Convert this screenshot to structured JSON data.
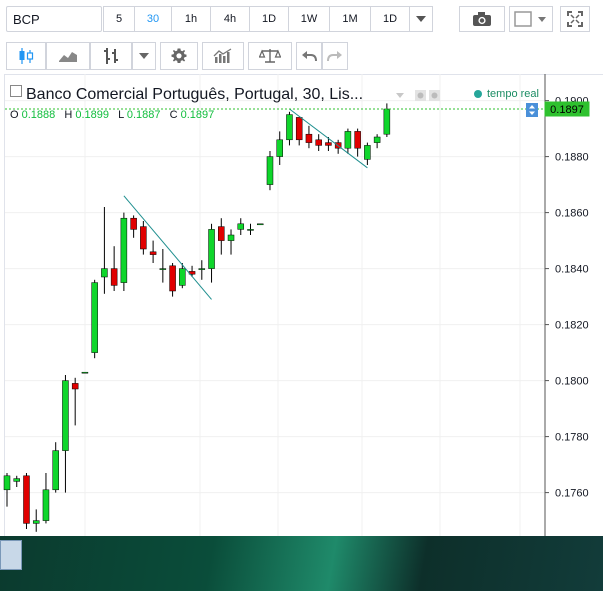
{
  "toolbar": {
    "symbol_value": "BCP",
    "intervals": [
      {
        "label": "5",
        "active": false
      },
      {
        "label": "30",
        "active": true
      },
      {
        "label": "1h",
        "active": false
      },
      {
        "label": "4h",
        "active": false
      },
      {
        "label": "1D",
        "active": false
      },
      {
        "label": "1W",
        "active": false
      },
      {
        "label": "1M",
        "active": false
      },
      {
        "label": "1D",
        "active": false
      }
    ]
  },
  "legend": {
    "title": "Banco Comercial Português, Portugal, 30, Lis...",
    "o_label": "O",
    "o_value": "0.1888",
    "h_label": "H",
    "h_value": "0.1899",
    "l_label": "L",
    "l_value": "0.1887",
    "c_label": "C",
    "c_value": "0.1897",
    "realtime": "tempo real"
  },
  "colors": {
    "up": "#0fd62b",
    "down": "#e00000",
    "trendline": "#1f8f8f",
    "price_line": "#2ec12e"
  },
  "chart_data": {
    "type": "candlestick",
    "y_ticks": [
      "0.1900",
      "0.1880",
      "0.1860",
      "0.1840",
      "0.1820",
      "0.1800",
      "0.1780",
      "0.1760"
    ],
    "ylim": [
      0.17445,
      0.19095
    ],
    "current_price": "0.1897",
    "candles": [
      {
        "o": 0.1761,
        "h": 0.1767,
        "l": 0.1755,
        "c": 0.1766
      },
      {
        "o": 0.1764,
        "h": 0.1766,
        "l": 0.1762,
        "c": 0.1765
      },
      {
        "o": 0.1766,
        "h": 0.1767,
        "l": 0.1747,
        "c": 0.1749
      },
      {
        "o": 0.1749,
        "h": 0.1754,
        "l": 0.1746,
        "c": 0.175
      },
      {
        "o": 0.175,
        "h": 0.1767,
        "l": 0.1749,
        "c": 0.1761
      },
      {
        "o": 0.1761,
        "h": 0.1778,
        "l": 0.176,
        "c": 0.1775
      },
      {
        "o": 0.1775,
        "h": 0.1802,
        "l": 0.176,
        "c": 0.18
      },
      {
        "o": 0.1799,
        "h": 0.1801,
        "l": 0.1784,
        "c": 0.1797
      },
      {
        "o": 0.1803,
        "h": 0.1803,
        "l": 0.1803,
        "c": 0.1803
      },
      {
        "o": 0.181,
        "h": 0.1836,
        "l": 0.1808,
        "c": 0.1835
      },
      {
        "o": 0.1837,
        "h": 0.1862,
        "l": 0.1831,
        "c": 0.184
      },
      {
        "o": 0.184,
        "h": 0.1848,
        "l": 0.1832,
        "c": 0.1834
      },
      {
        "o": 0.1835,
        "h": 0.186,
        "l": 0.1832,
        "c": 0.1858
      },
      {
        "o": 0.1858,
        "h": 0.1859,
        "l": 0.1851,
        "c": 0.1854
      },
      {
        "o": 0.1855,
        "h": 0.1857,
        "l": 0.1845,
        "c": 0.1847
      },
      {
        "o": 0.1846,
        "h": 0.185,
        "l": 0.1842,
        "c": 0.1845
      },
      {
        "o": 0.184,
        "h": 0.1847,
        "l": 0.1835,
        "c": 0.184
      },
      {
        "o": 0.1841,
        "h": 0.1842,
        "l": 0.183,
        "c": 0.1832
      },
      {
        "o": 0.1834,
        "h": 0.1842,
        "l": 0.1833,
        "c": 0.184
      },
      {
        "o": 0.1839,
        "h": 0.1841,
        "l": 0.1837,
        "c": 0.1838
      },
      {
        "o": 0.184,
        "h": 0.1843,
        "l": 0.1836,
        "c": 0.184
      },
      {
        "o": 0.184,
        "h": 0.1856,
        "l": 0.1835,
        "c": 0.1854
      },
      {
        "o": 0.1855,
        "h": 0.1858,
        "l": 0.1845,
        "c": 0.185
      },
      {
        "o": 0.185,
        "h": 0.1854,
        "l": 0.1845,
        "c": 0.1852
      },
      {
        "o": 0.1854,
        "h": 0.1858,
        "l": 0.1852,
        "c": 0.1856
      },
      {
        "o": 0.1854,
        "h": 0.1856,
        "l": 0.1852,
        "c": 0.1854
      },
      {
        "o": 0.1856,
        "h": 0.1856,
        "l": 0.1856,
        "c": 0.1856
      },
      {
        "o": 0.187,
        "h": 0.1882,
        "l": 0.1868,
        "c": 0.188
      },
      {
        "o": 0.188,
        "h": 0.1889,
        "l": 0.1877,
        "c": 0.1886
      },
      {
        "o": 0.1886,
        "h": 0.1896,
        "l": 0.1884,
        "c": 0.1895
      },
      {
        "o": 0.1894,
        "h": 0.1894,
        "l": 0.1884,
        "c": 0.1886
      },
      {
        "o": 0.1888,
        "h": 0.1891,
        "l": 0.1883,
        "c": 0.1885
      },
      {
        "o": 0.1886,
        "h": 0.1888,
        "l": 0.1882,
        "c": 0.1884
      },
      {
        "o": 0.1885,
        "h": 0.1887,
        "l": 0.1882,
        "c": 0.1884
      },
      {
        "o": 0.1885,
        "h": 0.1886,
        "l": 0.1881,
        "c": 0.1883
      },
      {
        "o": 0.1883,
        "h": 0.189,
        "l": 0.1881,
        "c": 0.1889
      },
      {
        "o": 0.1889,
        "h": 0.189,
        "l": 0.188,
        "c": 0.1883
      },
      {
        "o": 0.1879,
        "h": 0.1885,
        "l": 0.1877,
        "c": 0.1884
      },
      {
        "o": 0.1885,
        "h": 0.1888,
        "l": 0.1883,
        "c": 0.1887
      },
      {
        "o": 0.1888,
        "h": 0.1899,
        "l": 0.1887,
        "c": 0.1897
      }
    ],
    "trendlines": [
      {
        "from": {
          "i": 12,
          "v": 0.1866
        },
        "to": {
          "i": 21,
          "v": 0.1829
        }
      },
      {
        "from": {
          "i": 29,
          "v": 0.1897
        },
        "to": {
          "i": 37,
          "v": 0.1876
        }
      }
    ]
  }
}
